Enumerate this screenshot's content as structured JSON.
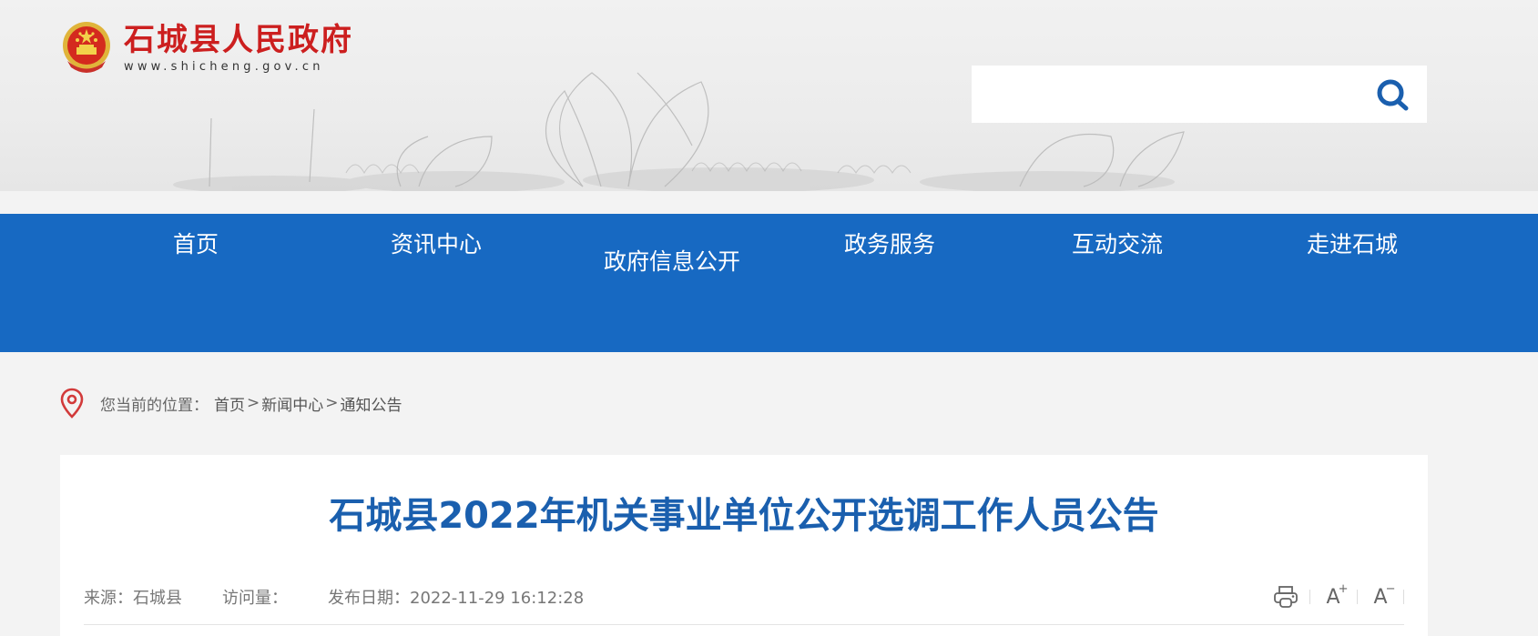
{
  "site": {
    "name": "石城县人民政府",
    "url": "www.shicheng.gov.cn"
  },
  "search": {
    "placeholder": "",
    "value": ""
  },
  "nav": {
    "items": [
      "首页",
      "资讯中心",
      "政府信息公开",
      "政务服务",
      "互动交流",
      "走进石城"
    ]
  },
  "breadcrumb": {
    "label": "您当前的位置：",
    "items": [
      "首页",
      "新闻中心",
      "通知公告"
    ],
    "separator": ">"
  },
  "article": {
    "title": "石城县2022年机关事业单位公开选调工作人员公告",
    "source": "来源：石城县",
    "visits": "访问量：",
    "date": "发布日期：2022-11-29 16:12:28"
  },
  "tools": {
    "enlarge": "A",
    "shrink": "A",
    "enlarge_sign": "+",
    "shrink_sign": "−"
  },
  "colors": {
    "nav_bg": "#1769c2",
    "title": "#1a5fae",
    "logo_red": "#cc1f1f",
    "pin_red": "#d23a3a"
  },
  "icons": [
    "national-emblem-icon",
    "search-icon",
    "location-pin-icon",
    "print-icon"
  ]
}
